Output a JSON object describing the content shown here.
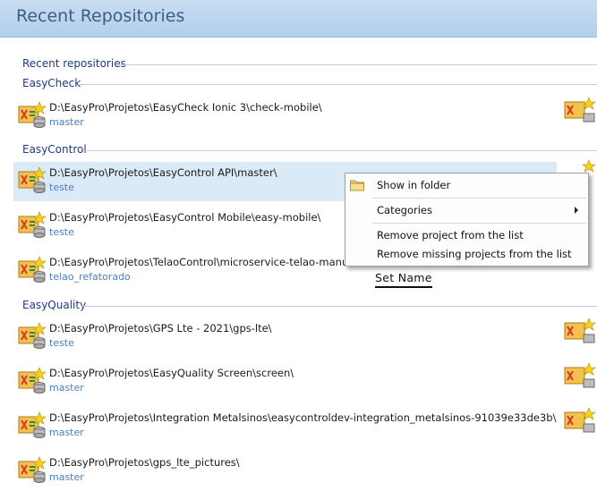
{
  "window": {
    "title": "Recent Repositories"
  },
  "section_label": "Recent repositories",
  "groups": [
    {
      "name": "EasyCheck"
    },
    {
      "name": "EasyControl"
    },
    {
      "name": "EasyQuality"
    }
  ],
  "repos": [
    {
      "path": "D:\\EasyPro\\Projetos\\EasyCheck Ionic 3\\check-mobile\\",
      "branch": "master"
    },
    {
      "path": "D:\\EasyPro\\Projetos\\EasyControl API\\master\\",
      "branch": "teste"
    },
    {
      "path": "D:\\EasyPro\\Projetos\\EasyControl Mobile\\easy-mobile\\",
      "branch": "teste"
    },
    {
      "path": "D:\\EasyPro\\Projetos\\TelaoControl\\microservice-telao-manuten",
      "branch": "telao_refatorado"
    },
    {
      "path": "D:\\EasyPro\\Projetos\\GPS Lte - 2021\\gps-lte\\",
      "branch": "teste"
    },
    {
      "path": "D:\\EasyPro\\Projetos\\EasyQuality Screen\\screen\\",
      "branch": "master"
    },
    {
      "path": "D:\\EasyPro\\Projetos\\Integration Metalsinos\\easycontroldev-integration_metalsinos-91039e33de3b\\",
      "branch": "master"
    },
    {
      "path": "D:\\EasyPro\\Projetos\\gps_lte_pictures\\",
      "branch": "master"
    }
  ],
  "context_menu": {
    "items": [
      {
        "label": "Show in folder",
        "icon": "folder-icon"
      },
      {
        "label": "Categories",
        "submenu": true
      },
      {
        "label": "Remove project from the list"
      },
      {
        "label": "Remove missing projects from the list"
      }
    ]
  },
  "tooltip_label": "Set Name",
  "colors": {
    "titlebar": "#b9d3ec",
    "selection": "#dbeaf7",
    "branch_text": "#4a7ec0",
    "group_text": "#1f3a7a"
  }
}
